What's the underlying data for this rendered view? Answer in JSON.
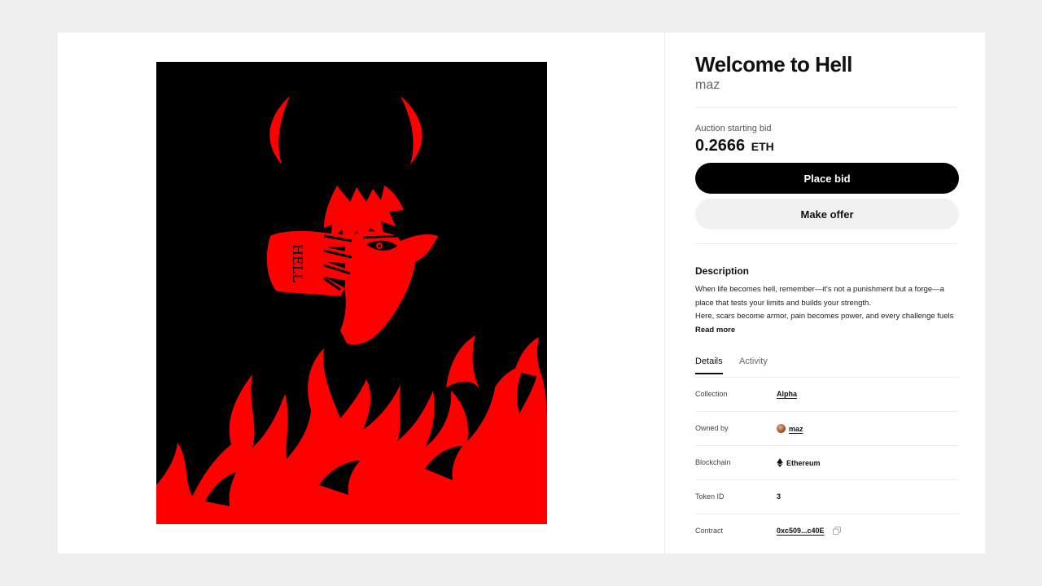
{
  "artwork": {
    "alt_text": "HELL"
  },
  "item": {
    "title": "Welcome to Hell",
    "artist": "maz"
  },
  "auction": {
    "label": "Auction starting bid",
    "amount": "0.2666",
    "currency": "ETH"
  },
  "actions": {
    "place_bid": "Place bid",
    "make_offer": "Make offer"
  },
  "description": {
    "heading": "Description",
    "line1": "When life becomes hell, remember—it's not a punishment but a forge—a",
    "line2": "place that tests your limits and builds your strength.",
    "line3": "Here, scars become armor, pain becomes power, and every challenge fuels",
    "read_more": "Read more"
  },
  "tabs": {
    "details": "Details",
    "activity": "Activity"
  },
  "details": {
    "collection_label": "Collection",
    "collection_value": "Alpha",
    "owner_label": "Owned by",
    "owner_value": "maz",
    "blockchain_label": "Blockchain",
    "blockchain_value": "Ethereum",
    "token_label": "Token ID",
    "token_value": "3",
    "contract_label": "Contract",
    "contract_value": "0xc509...c40E"
  },
  "colors": {
    "accent_red": "#ff0000",
    "primary_button": "#000000",
    "secondary_button": "#f1f1f1"
  },
  "icons": [
    "ethereum-icon",
    "copy-icon",
    "avatar"
  ]
}
